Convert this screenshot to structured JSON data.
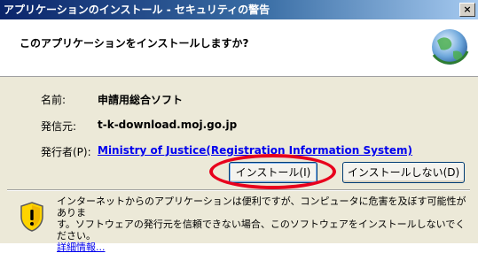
{
  "window": {
    "title": "アプリケーションのインストール - セキュリティの警告",
    "close_label": "×"
  },
  "header": {
    "question": "このアプリケーションをインストールしますか?",
    "icon": "globe-icon"
  },
  "details": {
    "name_label": "名前:",
    "name_value": "申請用総合ソフト",
    "from_label": "発信元:",
    "from_value": "t-k-download.moj.go.jp",
    "publisher_label": "発行者(P):",
    "publisher_value": "Ministry of Justice(Registration Information System)"
  },
  "buttons": {
    "install": "インストール(I)",
    "dont_install": "インストールしない(D)"
  },
  "warning": {
    "text_line1": "インターネットからのアプリケーションは便利ですが、コンピュータに危害を及ぼす可能性がありま",
    "text_line2": "す。ソフトウェアの発行元を信頼できない場合、このソフトウェアをインストールしないでください。",
    "more_info": "詳細情報...",
    "icon": "shield-warning-icon"
  },
  "colors": {
    "highlight_ring": "#e8001c",
    "title_bar": "#0a246a",
    "link": "#0000ee"
  }
}
